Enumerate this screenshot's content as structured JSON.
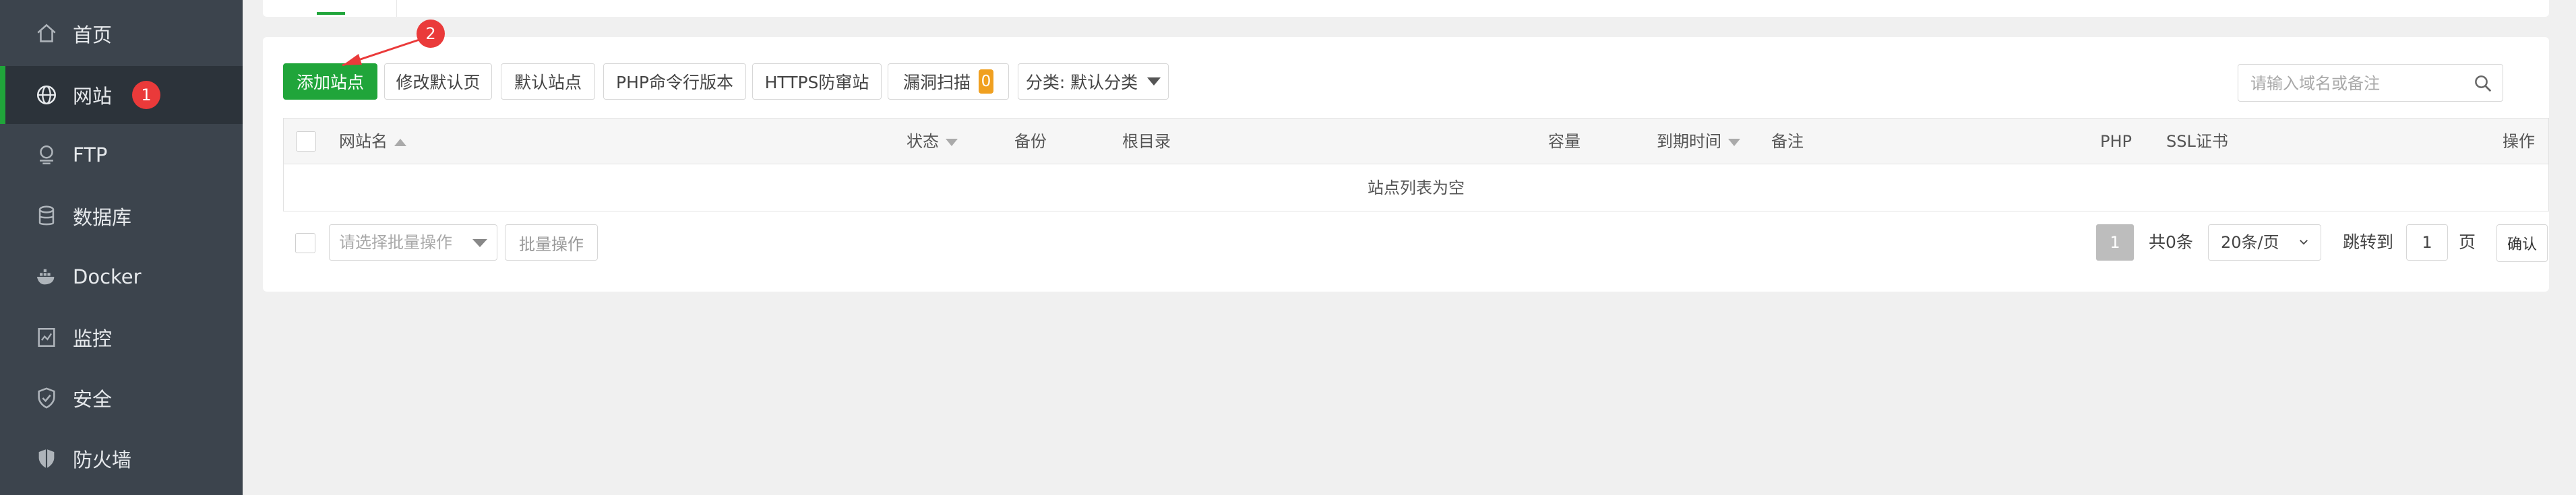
{
  "sidebar": {
    "items": [
      {
        "label": "首页",
        "icon": "home-icon"
      },
      {
        "label": "网站",
        "icon": "globe-icon",
        "active": true
      },
      {
        "label": "FTP",
        "icon": "ftp-icon"
      },
      {
        "label": "数据库",
        "icon": "database-icon"
      },
      {
        "label": "Docker",
        "icon": "docker-icon"
      },
      {
        "label": "监控",
        "icon": "monitor-icon"
      },
      {
        "label": "安全",
        "icon": "shield-check-icon"
      },
      {
        "label": "防火墙",
        "icon": "firewall-shield-icon"
      }
    ]
  },
  "annotations": {
    "step1": "1",
    "step2": "2"
  },
  "toolbar": {
    "add_site": "添加站点",
    "modify_default_page": "修改默认页",
    "default_site": "默认站点",
    "php_cli_version": "PHP命令行版本",
    "https_protection": "HTTPS防窜站",
    "vuln_scan": "漏洞扫描",
    "vuln_count": "0",
    "category": "分类: 默认分类"
  },
  "search": {
    "placeholder": "请输入域名或备注"
  },
  "table": {
    "columns": [
      "网站名",
      "状态",
      "备份",
      "根目录",
      "容量",
      "到期时间",
      "备注",
      "PHP",
      "SSL证书",
      "操作"
    ],
    "empty_text": "站点列表为空"
  },
  "batch": {
    "select_placeholder": "请选择批量操作",
    "button": "批量操作"
  },
  "pager": {
    "current": "1",
    "total": "共0条",
    "per_page": "20条/页",
    "jump_label": "跳转到",
    "jump_value": "1",
    "page_unit": "页",
    "confirm": "确认"
  },
  "colors": {
    "accent": "#20a53a",
    "sidebar_bg": "#3c444d",
    "badge": "#ea3a3a",
    "count_badge": "#f0a020"
  }
}
